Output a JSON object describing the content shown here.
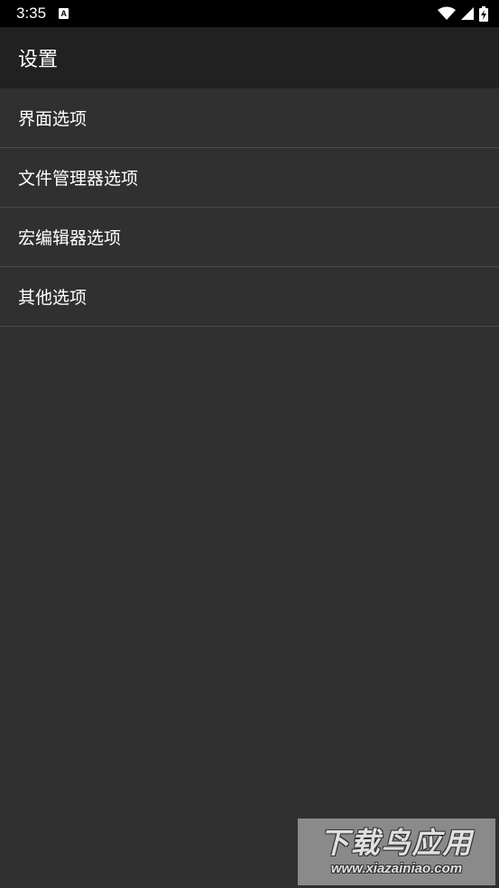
{
  "status_bar": {
    "time": "3:35",
    "notification_icon_letter": "A",
    "icons": [
      "notification-a-icon",
      "wifi-icon",
      "signal-icon",
      "battery-charging-icon"
    ]
  },
  "app_bar": {
    "title": "设置"
  },
  "preferences": {
    "items": [
      {
        "label": "界面选项"
      },
      {
        "label": "文件管理器选项"
      },
      {
        "label": "宏编辑器选项"
      },
      {
        "label": "其他选项"
      }
    ]
  },
  "watermark": {
    "logo_text": "下载鸟应用",
    "url": "www.xiazainiao.com"
  },
  "colors": {
    "background": "#303030",
    "app_bar": "#212121",
    "status_bar": "#000000",
    "divider": "#4a4a4a",
    "text": "#ffffff"
  }
}
